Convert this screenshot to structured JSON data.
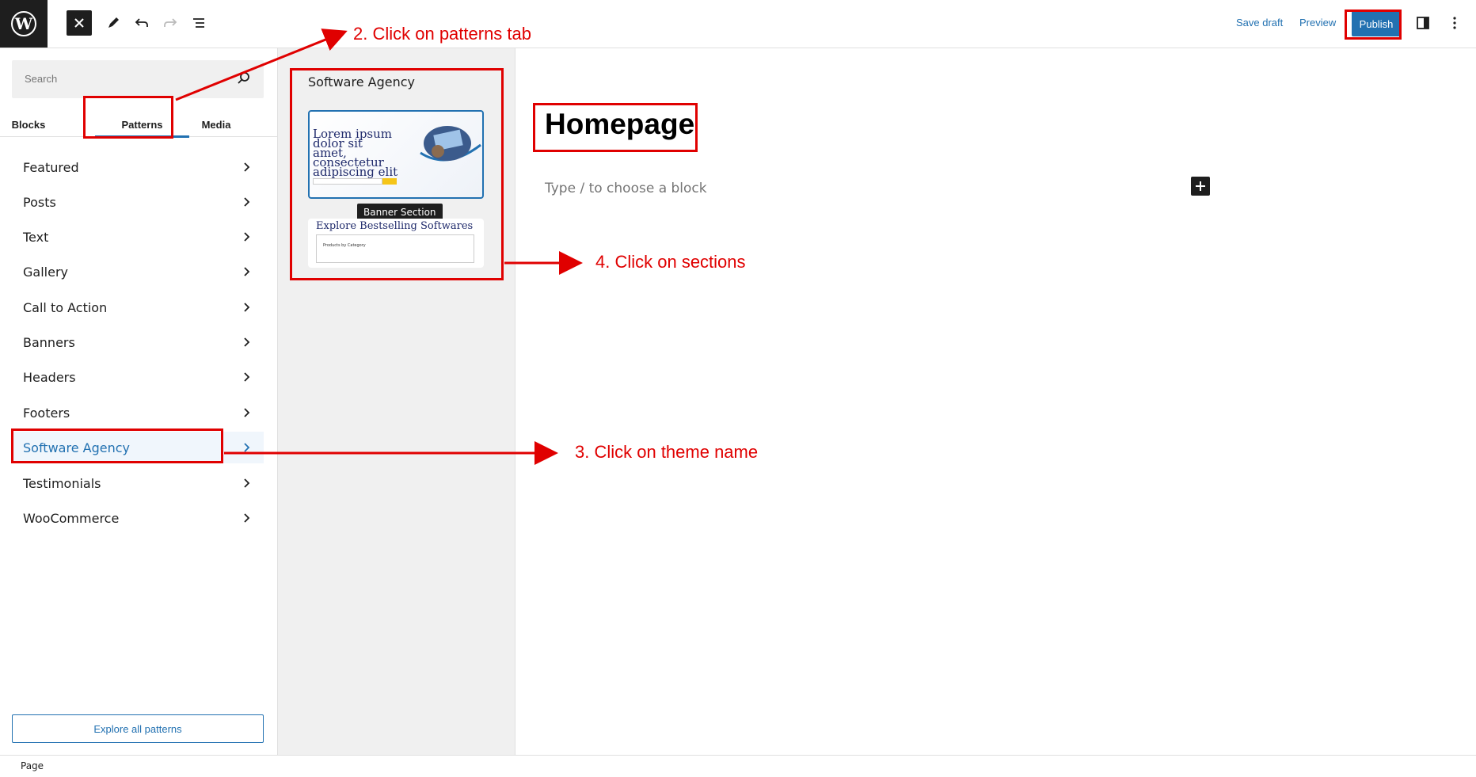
{
  "topbar": {
    "save_draft_label": "Save draft",
    "preview_label": "Preview",
    "publish_label": "Publish"
  },
  "sidebar": {
    "search_placeholder": "Search",
    "tabs": [
      {
        "label": "Blocks"
      },
      {
        "label": "Patterns"
      },
      {
        "label": "Media"
      }
    ],
    "categories": [
      {
        "label": "Featured"
      },
      {
        "label": "Posts"
      },
      {
        "label": "Text"
      },
      {
        "label": "Gallery"
      },
      {
        "label": "Call to Action"
      },
      {
        "label": "Banners"
      },
      {
        "label": "Headers"
      },
      {
        "label": "Footers"
      },
      {
        "label": "Software Agency"
      },
      {
        "label": "Testimonials"
      },
      {
        "label": "WooCommerce"
      }
    ],
    "explore_label": "Explore all patterns"
  },
  "pattern_panel": {
    "title": "Software Agency",
    "banner_card_text": "Lorem ipsum dolor sit amet, consectetur adipiscing elit",
    "tooltip": "Banner Section",
    "explore_card_heading": "Explore Bestselling Softwares",
    "explore_card_subtext": "Products by Category"
  },
  "canvas": {
    "page_title": "Homepage",
    "block_placeholder": "Type / to choose a block"
  },
  "statusbar": {
    "label": "Page"
  },
  "annotations": [
    {
      "text": "2. Click on patterns tab"
    },
    {
      "text": "4. Click on sections"
    },
    {
      "text": "3. Click on theme name"
    }
  ],
  "colors": {
    "accent": "#2271b1",
    "annotation": "#e00000",
    "dark": "#1e1e1e"
  }
}
